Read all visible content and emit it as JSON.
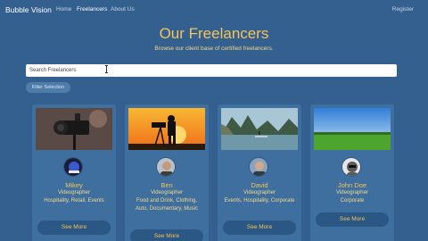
{
  "nav": {
    "brand": "Bubble Vision",
    "links": [
      "Home",
      "Freelancers",
      "About Us"
    ],
    "register": "Register"
  },
  "hero": {
    "title": "Our Freelancers",
    "subtitle": "Browse our client base of certified freelancers."
  },
  "search": {
    "placeholder": "Search Freelancers"
  },
  "filter": {
    "label": "Filter Selection"
  },
  "cards": [
    {
      "name": "Mikey",
      "role": "Videographer",
      "details": "Hospitality, Retail, Events",
      "button": "See More",
      "image_icon": "camera-icon",
      "avatar_icon": "avatar-logo-icon"
    },
    {
      "name": "Ben",
      "role": "Videographer",
      "details": "Food and Drink, Clothing, Auto, Documentary, Music",
      "button": "See More",
      "image_icon": "sunset-camera-icon",
      "avatar_icon": "avatar-person-icon"
    },
    {
      "name": "David",
      "role": "Videographer",
      "details": "Events, Hospitality, Corporate",
      "button": "See More",
      "image_icon": "lake-landscape-icon",
      "avatar_icon": "avatar-person-icon"
    },
    {
      "name": "John Doe",
      "role": "Videographer",
      "details": "Corporate",
      "button": "See More",
      "image_icon": "field-landscape-icon",
      "avatar_icon": "avatar-placeholder-icon"
    }
  ],
  "colors": {
    "background": "#33608f",
    "card": "#3e6f9f",
    "accent": "#f4c35a",
    "button": "#2b5784"
  }
}
